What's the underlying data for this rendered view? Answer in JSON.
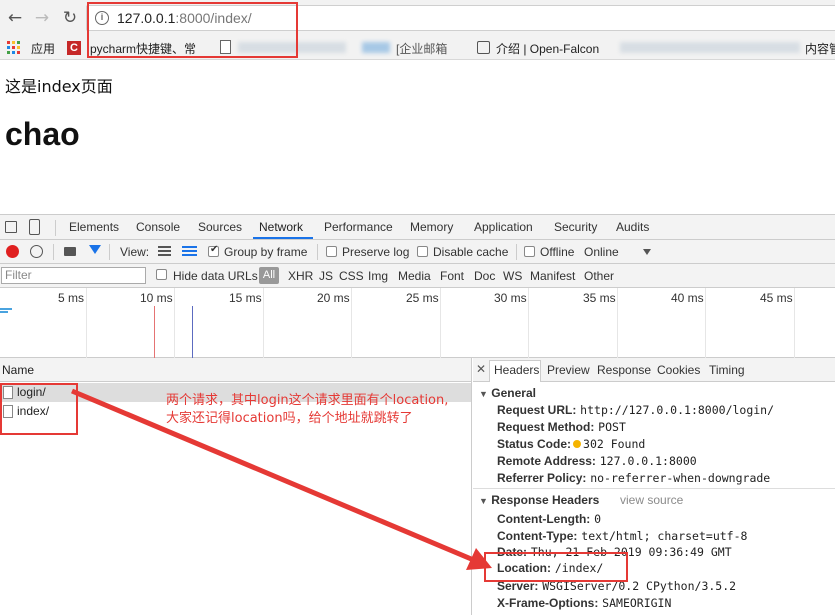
{
  "browser": {
    "url_host": "127.0.0.1",
    "url_path": ":8000/index/",
    "bookmarks": [
      {
        "label": "应用"
      },
      {
        "label": "pycharm快捷键、常"
      },
      {
        "label": "[企业邮箱"
      },
      {
        "label": "介绍 | Open-Falcon"
      },
      {
        "label": "内容管"
      }
    ]
  },
  "page": {
    "text": "这是index页面",
    "heading": "chao"
  },
  "devtools": {
    "tabs": [
      "Elements",
      "Console",
      "Sources",
      "Network",
      "Performance",
      "Memory",
      "Application",
      "Security",
      "Audits"
    ],
    "active_tab": "Network",
    "toolbar": {
      "view_label": "View:",
      "group_by_frame": "Group by frame",
      "preserve_log": "Preserve log",
      "disable_cache": "Disable cache",
      "offline": "Offline",
      "throttle": "Online"
    },
    "filter": {
      "placeholder": "Filter",
      "hide_data_urls": "Hide data URLs",
      "types": [
        "All",
        "XHR",
        "JS",
        "CSS",
        "Img",
        "Media",
        "Font",
        "Doc",
        "WS",
        "Manifest",
        "Other"
      ]
    },
    "timeline_labels": [
      "5 ms",
      "10 ms",
      "15 ms",
      "20 ms",
      "25 ms",
      "30 ms",
      "35 ms",
      "40 ms",
      "45 ms"
    ],
    "name_header": "Name",
    "requests": [
      {
        "name": "login/"
      },
      {
        "name": "index/"
      }
    ],
    "detail_tabs": [
      "Headers",
      "Preview",
      "Response",
      "Cookies",
      "Timing"
    ],
    "general": {
      "title": "General",
      "rows": [
        {
          "key": "Request URL:",
          "value": "http://127.0.0.1:8000/login/"
        },
        {
          "key": "Request Method:",
          "value": "POST"
        },
        {
          "key": "Status Code:",
          "value": "302 Found"
        },
        {
          "key": "Remote Address:",
          "value": "127.0.0.1:8000"
        },
        {
          "key": "Referrer Policy:",
          "value": "no-referrer-when-downgrade"
        }
      ]
    },
    "response_headers": {
      "title": "Response Headers",
      "view_source": "view source",
      "rows": [
        {
          "key": "Content-Length:",
          "value": "0"
        },
        {
          "key": "Content-Type:",
          "value": "text/html; charset=utf-8"
        },
        {
          "key": "Date:",
          "value": "Thu, 21 Feb 2019 09:36:49 GMT"
        },
        {
          "key": "Location:",
          "value": "/index/"
        },
        {
          "key": "Server:",
          "value": "WSGIServer/0.2 CPython/3.5.2"
        },
        {
          "key": "X-Frame-Options:",
          "value": "SAMEORIGIN"
        }
      ]
    }
  },
  "annotation": {
    "line1": "两个请求，其中login这个请求里面有个location,",
    "line2": "大家还记得location吗，给个地址就跳转了",
    "color": "#e53935"
  }
}
